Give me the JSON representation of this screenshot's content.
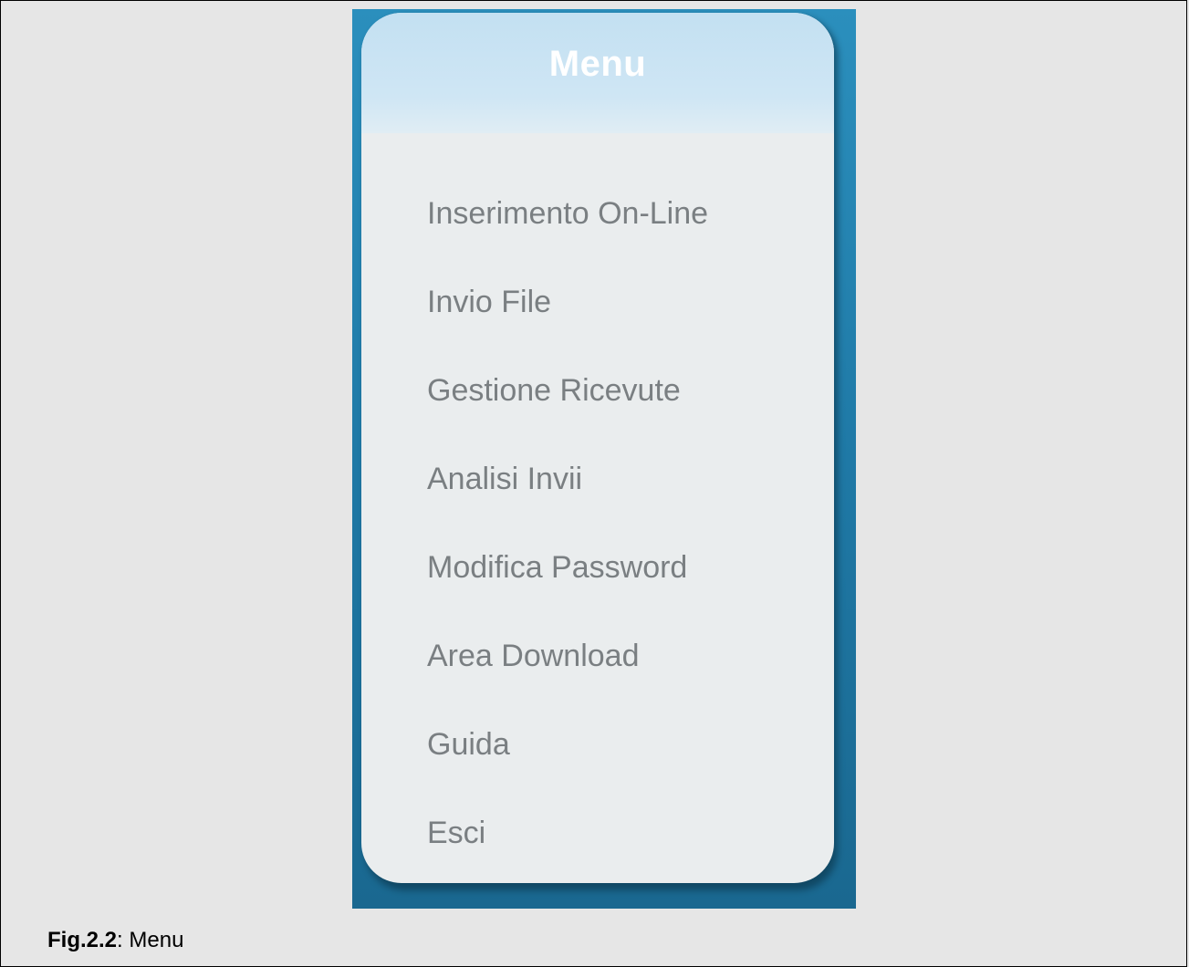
{
  "menu": {
    "title": "Menu",
    "items": [
      {
        "label": "Inserimento On-Line"
      },
      {
        "label": "Invio File"
      },
      {
        "label": "Gestione Ricevute"
      },
      {
        "label": "Analisi Invii"
      },
      {
        "label": "Modifica Password"
      },
      {
        "label": "Area Download"
      },
      {
        "label": "Guida"
      },
      {
        "label": "Esci"
      }
    ]
  },
  "caption": {
    "figure_label": "Fig.2.2",
    "separator": ": ",
    "text": "Menu"
  },
  "colors": {
    "background_blue": "#2b8fbd",
    "header": "#c8e3f3",
    "panel": "#eaedee",
    "item_text": "#7a7f82"
  }
}
